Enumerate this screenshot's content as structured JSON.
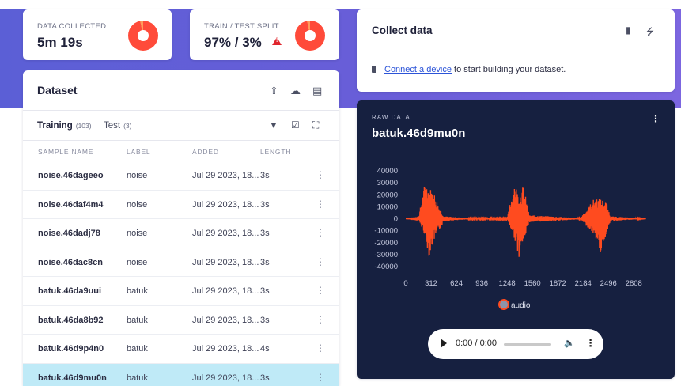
{
  "stats": {
    "collected_label": "DATA COLLECTED",
    "collected_value": "5m 19s",
    "split_label": "TRAIN / TEST SPLIT",
    "split_value": "97% / 3%",
    "train_fraction": 0.97
  },
  "dataset": {
    "title": "Dataset",
    "toolbar_icons": [
      "upload-icon",
      "cloud-icon",
      "document-icon"
    ],
    "tabs": [
      {
        "label": "Training",
        "count": "(103)"
      },
      {
        "label": "Test",
        "count": "(3)"
      }
    ],
    "tab_icons": [
      "filter-icon",
      "select-icon",
      "expand-icon"
    ],
    "columns": [
      "SAMPLE NAME",
      "LABEL",
      "ADDED",
      "LENGTH"
    ],
    "rows": [
      {
        "name": "noise.46dageeo",
        "label": "noise",
        "added": "Jul 29 2023, 18...",
        "length": "3s"
      },
      {
        "name": "noise.46daf4m4",
        "label": "noise",
        "added": "Jul 29 2023, 18...",
        "length": "3s"
      },
      {
        "name": "noise.46dadj78",
        "label": "noise",
        "added": "Jul 29 2023, 18...",
        "length": "3s"
      },
      {
        "name": "noise.46dac8cn",
        "label": "noise",
        "added": "Jul 29 2023, 18...",
        "length": "3s"
      },
      {
        "name": "batuk.46da9uui",
        "label": "batuk",
        "added": "Jul 29 2023, 18...",
        "length": "3s"
      },
      {
        "name": "batuk.46da8b92",
        "label": "batuk",
        "added": "Jul 29 2023, 18...",
        "length": "3s"
      },
      {
        "name": "batuk.46d9p4n0",
        "label": "batuk",
        "added": "Jul 29 2023, 18...",
        "length": "4s"
      },
      {
        "name": "batuk.46d9mu0n",
        "label": "batuk",
        "added": "Jul 29 2023, 18...",
        "length": "3s",
        "selected": true
      }
    ]
  },
  "collect": {
    "title": "Collect data",
    "link_text": "Connect a device",
    "suffix_text": " to start building your dataset."
  },
  "raw": {
    "label": "RAW DATA",
    "title": "batuk.46d9mu0n",
    "legend": "audio",
    "line_color": "#ff4b1f",
    "player_time": "0:00 / 0:00"
  },
  "chart_data": {
    "type": "line",
    "title": "",
    "xlabel": "",
    "ylabel": "",
    "xlim": [
      0,
      3000
    ],
    "ylim": [
      -45000,
      45000
    ],
    "x_ticks": [
      0,
      312,
      624,
      936,
      1248,
      1560,
      1872,
      2184,
      2496,
      2808
    ],
    "y_ticks": [
      40000,
      30000,
      20000,
      10000,
      0,
      -10000,
      -20000,
      -30000,
      -40000
    ],
    "grid": false,
    "legend_position": "bottom",
    "series": [
      {
        "name": "audio",
        "approximate_envelope": [
          {
            "x": 0,
            "min": 0,
            "max": 0
          },
          {
            "x": 156,
            "min": -500,
            "max": 500
          },
          {
            "x": 240,
            "min": -15000,
            "max": 32000
          },
          {
            "x": 290,
            "min": -33000,
            "max": 26000
          },
          {
            "x": 340,
            "min": -20000,
            "max": 24000
          },
          {
            "x": 400,
            "min": -12000,
            "max": 12000
          },
          {
            "x": 470,
            "min": -2000,
            "max": 2000
          },
          {
            "x": 780,
            "min": -500,
            "max": 500
          },
          {
            "x": 1250,
            "min": -500,
            "max": 500
          },
          {
            "x": 1340,
            "min": -17000,
            "max": 32000
          },
          {
            "x": 1390,
            "min": -33000,
            "max": 20000
          },
          {
            "x": 1450,
            "min": -20000,
            "max": 28000
          },
          {
            "x": 1520,
            "min": -3000,
            "max": 3000
          },
          {
            "x": 2150,
            "min": -500,
            "max": 500
          },
          {
            "x": 2330,
            "min": -14000,
            "max": 18000
          },
          {
            "x": 2400,
            "min": -30000,
            "max": 17000
          },
          {
            "x": 2470,
            "min": -12000,
            "max": 14000
          },
          {
            "x": 2520,
            "min": -2000,
            "max": 2000
          },
          {
            "x": 2960,
            "min": 0,
            "max": 0
          }
        ]
      }
    ]
  }
}
